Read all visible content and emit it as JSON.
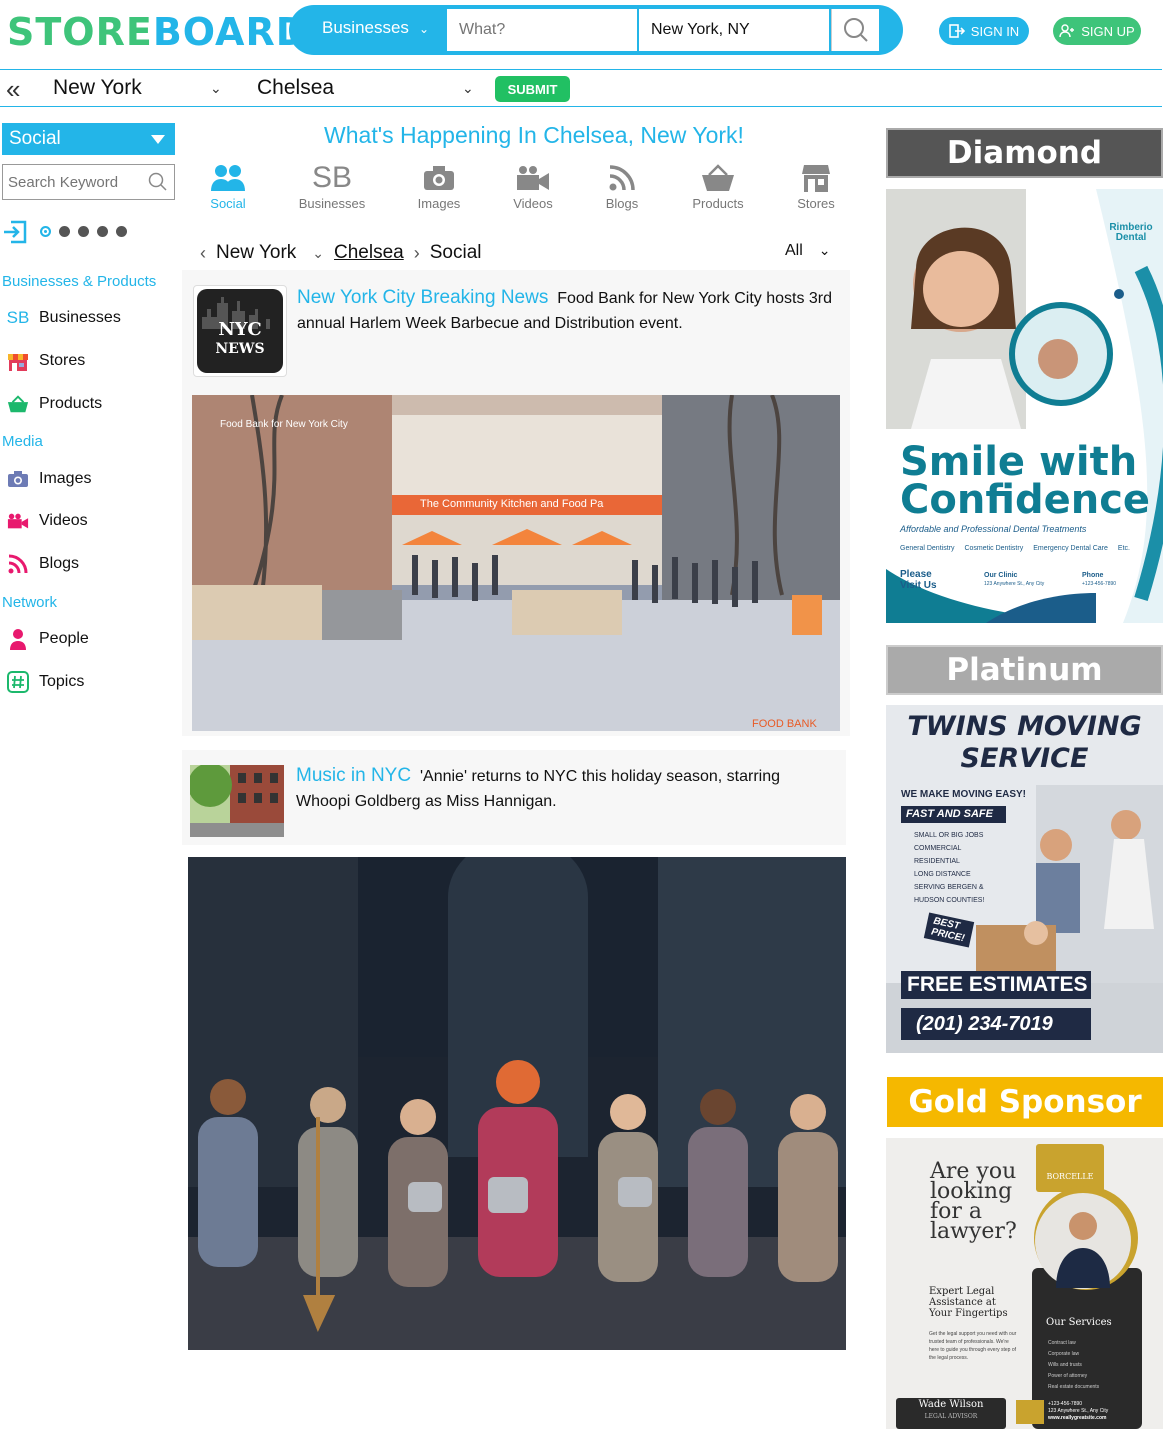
{
  "header": {
    "logo_part1": "STORE",
    "logo_part2": "BOARD",
    "category": "Businesses",
    "what_placeholder": "What?",
    "where_value": "New York, NY",
    "sign_in": "SIGN IN",
    "sign_up": "SIGN UP"
  },
  "location": {
    "city": "New York",
    "neighborhood": "Chelsea",
    "submit": "SUBMIT"
  },
  "sidebar": {
    "dropdown": "Social",
    "keyword_placeholder": "Search Keyword",
    "sections": [
      {
        "title": "Businesses & Products",
        "items": [
          "Businesses",
          "Stores",
          "Products"
        ]
      },
      {
        "title": "Media",
        "items": [
          "Images",
          "Videos",
          "Blogs"
        ]
      },
      {
        "title": "Network",
        "items": [
          "People",
          "Topics"
        ]
      }
    ],
    "sb_glyph": "SB"
  },
  "main": {
    "heading": "What's Happening In Chelsea, New York!",
    "tabs": [
      "Social",
      "Businesses",
      "Images",
      "Videos",
      "Blogs",
      "Products",
      "Stores"
    ],
    "tab_sb_glyph": "SB",
    "breadcrumb": [
      "New York",
      "Chelsea",
      "Social"
    ],
    "filter": "All",
    "posts": [
      {
        "source": "New York City Breaking News",
        "text": "Food Bank for New York City hosts 3rd annual Harlem Week Barbecue and Distribution event.",
        "thumb_text": [
          "NYC",
          "NEWS"
        ],
        "image_caption": "Food Bank for New York City",
        "awning_text": "The Community Kitchen and Food Pa",
        "watermark": "FOOD BANK"
      },
      {
        "source": "Music in NYC",
        "text": "'Annie' returns to NYC this holiday season, starring Whoopi Goldberg as Miss Hannigan."
      }
    ]
  },
  "sponsors": {
    "diamond": {
      "title": "Diamond Sponsor",
      "brand": "Rimberio Dental",
      "headline1": "Smile with",
      "headline2": "Confidence",
      "tagline": "Affordable and Professional Dental Treatments",
      "services": [
        "General Dentistry",
        "Cosmetic Dentistry",
        "Emergency Dental Care",
        "Etc."
      ],
      "visit": "Please Visit Us",
      "clinic": "Our Clinic",
      "address": "123 Anywhere St., Any City",
      "phone_label": "Phone",
      "phone": "+123-456-7890"
    },
    "platinum": {
      "title": "Platinum Sponsor",
      "name1": "TWINS MOVING",
      "name2": "SERVICE",
      "slogan": "WE MAKE MOVING EASY!",
      "fast": "FAST AND SAFE",
      "list": [
        "SMALL OR BIG JOBS",
        "COMMERCIAL",
        "RESIDENTIAL",
        "LONG DISTANCE",
        "SERVING BERGEN &",
        "HUDSON COUNTIES!"
      ],
      "best1": "BEST",
      "best2": "PRICE!",
      "estimates": "FREE ESTIMATES",
      "phone": "(201) 234-7019"
    },
    "gold": {
      "title": "Gold Sponsor",
      "q1": "Are you",
      "q2": "looking",
      "q3": "for a",
      "q4": "lawyer?",
      "brand": "BORCELLE",
      "sub": "Expert Legal Assistance at Your Fingertips",
      "body": "Get the legal support you need with our trusted team of professionals. We're here to guide you through every step of the legal process.",
      "services_title": "Our Services",
      "services": [
        "Contract law",
        "Corporate law",
        "Wills and trusts",
        "Power of attorney",
        "Real estate documents"
      ],
      "name": "Wade Wilson",
      "role": "LEGAL ADVISOR",
      "phone": "+123-456-7890",
      "address": "123 Anywhere St., Any City",
      "web": "www.reallygreatsite.com"
    }
  },
  "colors": {
    "brand_blue": "#23b5e8",
    "brand_green": "#3ec47a",
    "submit_green": "#21c063",
    "gold": "#f5b800"
  }
}
